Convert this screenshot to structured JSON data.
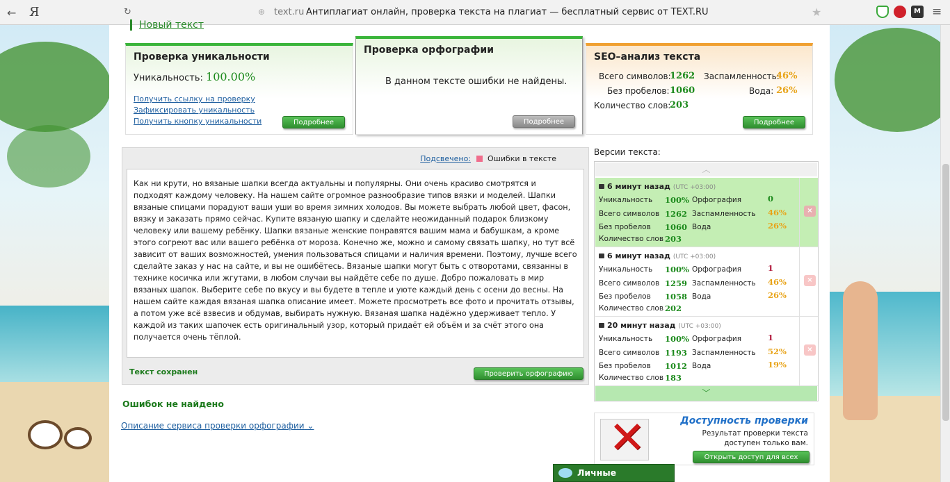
{
  "browser": {
    "back_glyph": "←",
    "yandex_glyph": "Я",
    "reload_glyph": "↻",
    "globe_glyph": "⊕",
    "domain": "text.ru",
    "title": "Антиплагиат онлайн, проверка текста на плагиат — бесплатный сервис от TEXT.RU",
    "star_glyph": "★",
    "menu_glyph": "≡",
    "ext_letter": "M",
    "icons": [
      "back-icon",
      "yandex-icon",
      "reload-icon",
      "globe-icon",
      "bookmark-star-icon",
      "shield-icon",
      "adblock-icon",
      "m-extension-icon",
      "menu-icon"
    ]
  },
  "new_text_link": "Новый текст",
  "uniqueness": {
    "title": "Проверка уникальности",
    "label": "Уникальность:",
    "value": "100.00%",
    "links": [
      "Получить ссылку на проверку",
      "Зафиксировать уникальность",
      "Получить кнопку уникальности"
    ],
    "button": "Подробнее"
  },
  "spelling": {
    "title": "Проверка орфографии",
    "message": "В данном тексте ошибки не найдены.",
    "button": "Подробнее"
  },
  "seo": {
    "title": "SEO–анализ текста",
    "total_chars_label": "Всего символов:",
    "total_chars": "1262",
    "no_spaces_label": "Без пробелов:",
    "no_spaces": "1060",
    "words_label": "Количество слов:",
    "words": "203",
    "spam_label": "Заспамленность:",
    "spam": "46%",
    "water_label": "Вода:",
    "water": "26%",
    "button": "Подробнее"
  },
  "editor": {
    "highlight_label": "Подсвечено:",
    "highlight_legend": "Ошибки в тексте",
    "text": "Как ни крути, но вязаные шапки всегда актуальны и популярны. Они очень красиво смотрятся и подходят каждому человеку. На нашем сайте огромное разнообразие типов вязки и моделей. Шапки вязаные спицами порадуют ваши уши во время зимних холодов. Вы можете выбрать любой цвет, фасон, вязку и заказать прямо сейчас. Купите вязаную шапку и сделайте неожиданный подарок близкому человеку или вашему ребёнку. Шапки вязаные женские понравятся вашим мама и бабушкам, а кроме этого согреют вас или вашего ребёнка от мороза. Конечно же, можно и самому связать шапку, но тут всё зависит от ваших возможностей, умения пользоваться спицами и наличия времени. Поэтому, лучше всего сделайте заказ у нас на сайте, и вы не ошибётесь. Вязаные шапки могут быть с отворотами, связанны в технике косичка или жгутами, в любом случаи вы найдёте себе по душе. Добро пожаловать в мир вязаных шапок. Выберите себе по вкусу и вы будете в тепле и уюте каждый день с осени до весны. На нашем сайте каждая вязаная шапка описание имеет. Можете просмотреть все фото и прочитать отзывы, а потом уже всё взвесив и обдумав, выбирать нужную. Вязаная шапка надёжно удерживает тепло. У каждой из таких шапочек есть оригинальный узор, который придаёт ей объём и за счёт этого она получается очень тёплой.",
    "saved_status": "Текст сохранен",
    "check_button": "Проверить орфографию"
  },
  "result": "Ошибок не найдено",
  "description_link": "Описание сервиса проверки орфографии",
  "versions": {
    "title": "Версии текста:",
    "labels": {
      "uniqueness": "Уникальность",
      "total": "Всего символов",
      "no_spaces": "Без пробелов",
      "words": "Количество слов",
      "spelling": "Орфография",
      "spam": "Заспамленность",
      "water": "Вода"
    },
    "up_glyph": "︿",
    "down_glyph": "﹀",
    "delete_glyph": "×",
    "items": [
      {
        "time": "6 минут назад",
        "tz": "(UTC +03:00)",
        "uniqueness": "100%",
        "total": "1262",
        "no_spaces": "1060",
        "words": "203",
        "spelling": "0",
        "spam": "46%",
        "water": "26%"
      },
      {
        "time": "6 минут назад",
        "tz": "(UTC +03:00)",
        "uniqueness": "100%",
        "total": "1259",
        "no_spaces": "1058",
        "words": "202",
        "spelling": "1",
        "spam": "46%",
        "water": "26%"
      },
      {
        "time": "20 минут назад",
        "tz": "(UTC +03:00)",
        "uniqueness": "100%",
        "total": "1193",
        "no_spaces": "1012",
        "words": "183",
        "spelling": "1",
        "spam": "52%",
        "water": "19%"
      }
    ]
  },
  "promo": {
    "title": "Доступность проверки",
    "text": "Результат проверки текста доступен только вам.",
    "button": "Открыть доступ для всех"
  },
  "messages_button": "Личные сообщения",
  "colors": {
    "green": "#1c8a1c",
    "orange": "#e8a317",
    "red": "#b0173a",
    "link": "#2060a0"
  }
}
